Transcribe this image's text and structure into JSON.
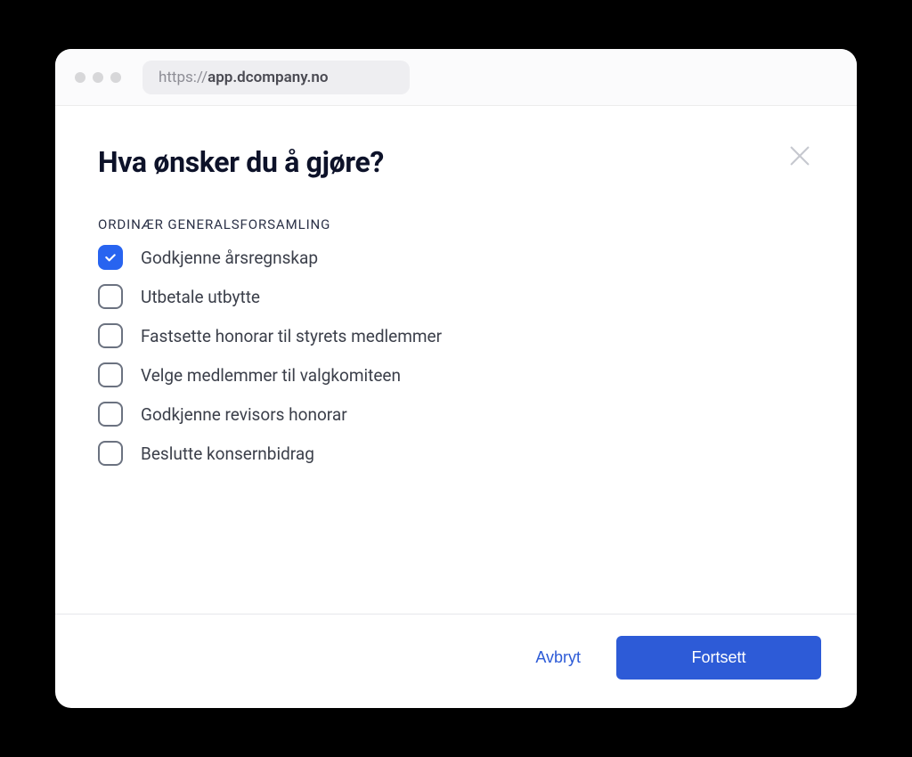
{
  "browser": {
    "url_protocol": "https://",
    "url_domain": "app.dcompany.no"
  },
  "modal": {
    "title": "Hva ønsker du å gjøre?",
    "section_label": "ORDINÆR GENERALSFORSAMLING",
    "options": [
      {
        "label": "Godkjenne årsregnskap",
        "checked": true
      },
      {
        "label": "Utbetale utbytte",
        "checked": false
      },
      {
        "label": "Fastsette honorar til styrets medlemmer",
        "checked": false
      },
      {
        "label": "Velge medlemmer til valgkomiteen",
        "checked": false
      },
      {
        "label": "Godkjenne revisors honorar",
        "checked": false
      },
      {
        "label": "Beslutte konsernbidrag",
        "checked": false
      }
    ],
    "cancel_label": "Avbryt",
    "continue_label": "Fortsett"
  }
}
